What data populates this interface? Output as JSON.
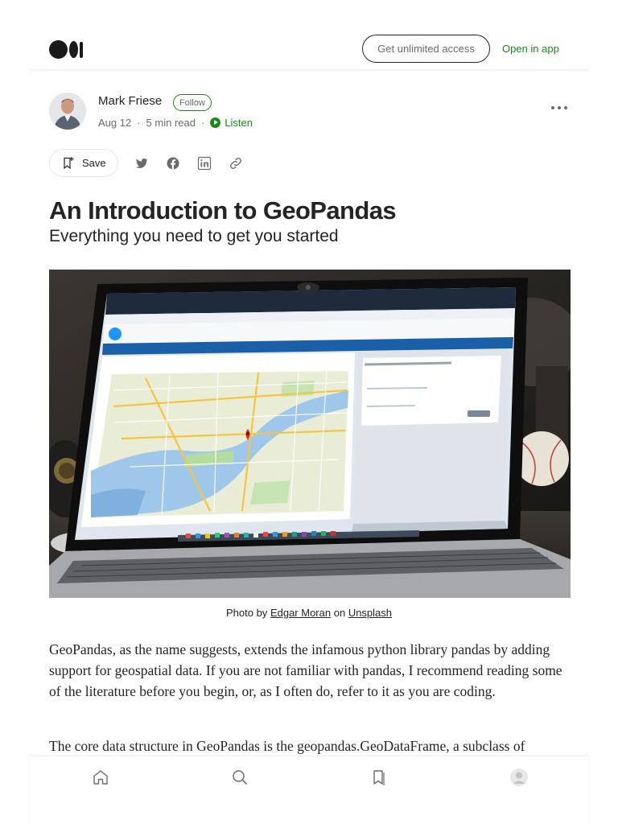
{
  "header": {
    "get_unlimited_label": "Get unlimited access",
    "open_app_label": "Open in app"
  },
  "author": {
    "name": "Mark Friese",
    "follow_label": "Follow",
    "date": "Aug 12",
    "read_time": "5 min read",
    "listen_label": "Listen"
  },
  "actions": {
    "save_label": "Save",
    "share_icons": [
      "twitter-icon",
      "facebook-icon",
      "linkedin-icon",
      "link-icon"
    ]
  },
  "article": {
    "title": "An Introduction to GeoPandas",
    "subtitle": "Everything you need to get you started",
    "caption_prefix": "Photo by",
    "caption_author": "Edgar Moran",
    "caption_on": "on",
    "caption_source": "Unsplash",
    "paragraph_1": "GeoPandas, as the name suggests, extends the infamous python library pandas by adding support for geospatial data. If you are not familiar with pandas, I recommend reading some of the literature before you begin, or, as I often do, refer to it as you are coding.",
    "paragraph_2": "The core data structure in GeoPandas is the geopandas.GeoDataFrame, a subclass of"
  },
  "bottom_nav": {
    "icons": [
      "home-icon",
      "search-icon",
      "bookmarks-icon",
      "profile-icon"
    ]
  },
  "colors": {
    "accent_green": "#1a8917",
    "text": "#242424",
    "muted": "#6b6b6b"
  }
}
